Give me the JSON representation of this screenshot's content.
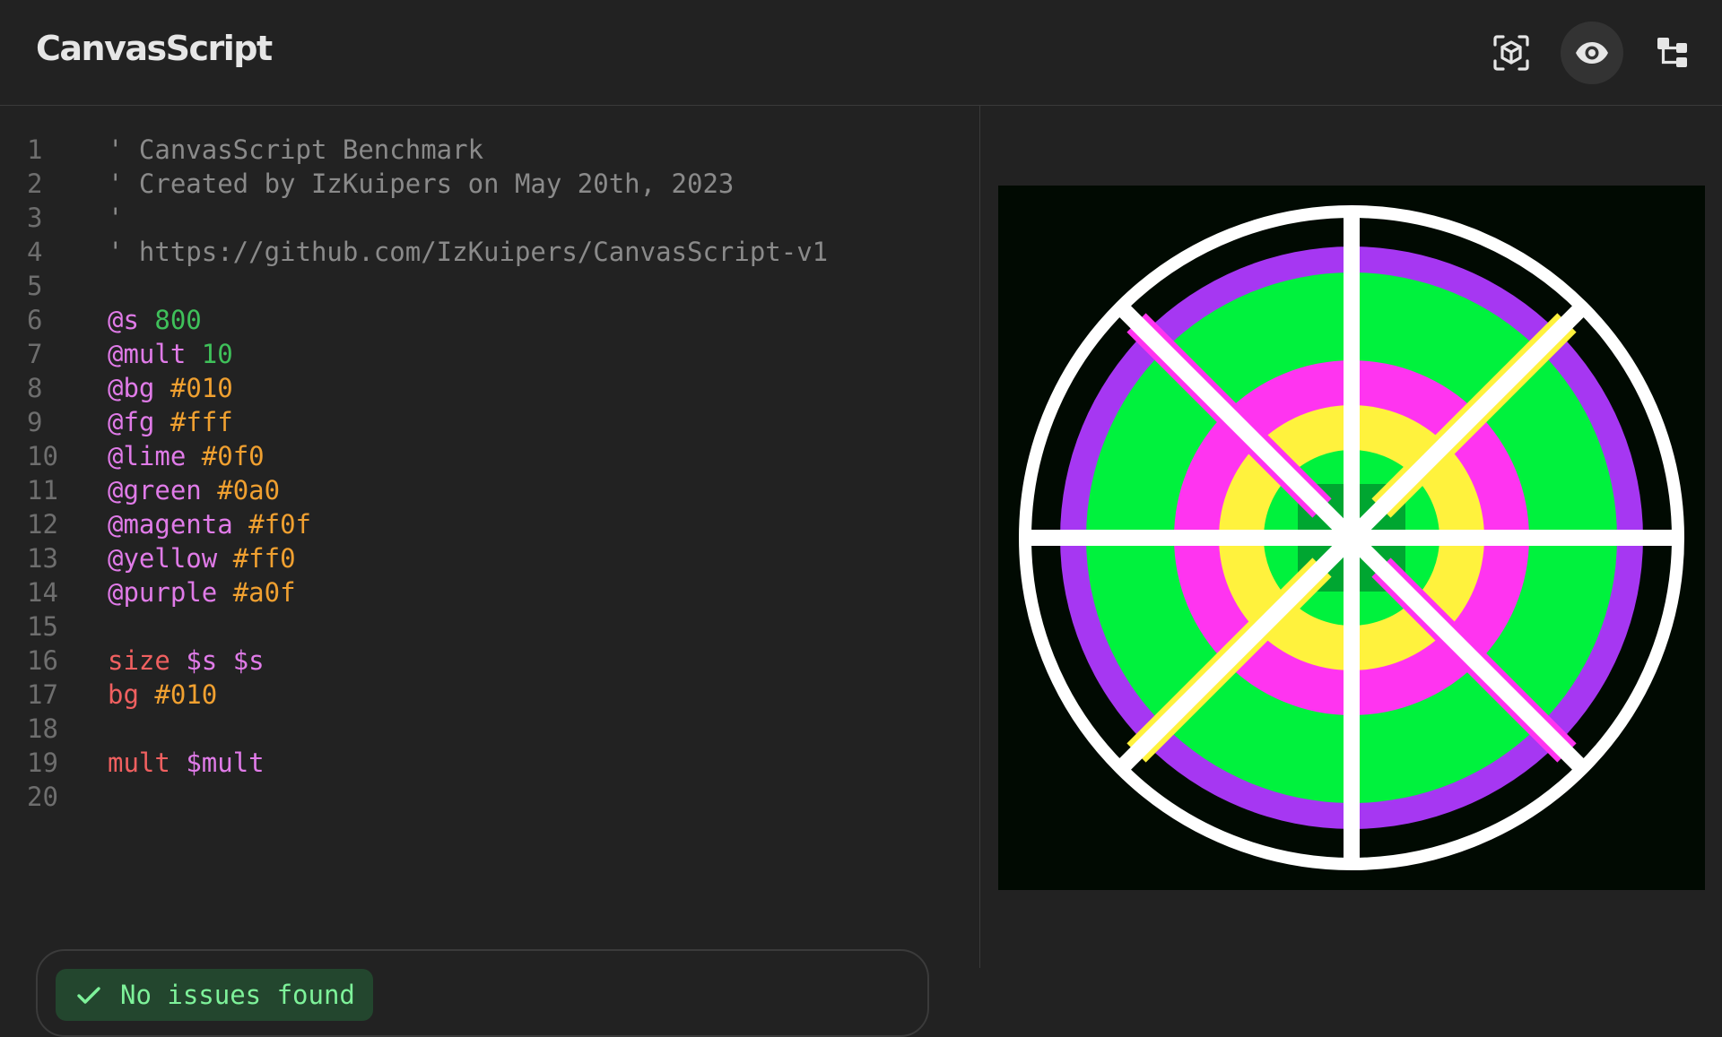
{
  "header": {
    "title": "CanvasScript",
    "icons": [
      "cube-scan-icon",
      "eye-icon",
      "tree-icon"
    ]
  },
  "editor": {
    "lines": [
      {
        "n": "1",
        "tokens": [
          {
            "t": "' CanvasScript Benchmark",
            "k": "comment"
          }
        ]
      },
      {
        "n": "2",
        "tokens": [
          {
            "t": "' Created by IzKuipers on May 20th, 2023",
            "k": "comment"
          }
        ]
      },
      {
        "n": "3",
        "tokens": [
          {
            "t": "'",
            "k": "comment"
          }
        ]
      },
      {
        "n": "4",
        "tokens": [
          {
            "t": "' https://github.com/IzKuipers/CanvasScript-v1",
            "k": "comment"
          }
        ]
      },
      {
        "n": "5",
        "tokens": []
      },
      {
        "n": "6",
        "tokens": [
          {
            "t": "@s",
            "k": "var"
          },
          {
            "t": " "
          },
          {
            "t": "800",
            "k": "num"
          }
        ]
      },
      {
        "n": "7",
        "tokens": [
          {
            "t": "@mult",
            "k": "var"
          },
          {
            "t": " "
          },
          {
            "t": "10",
            "k": "num"
          }
        ]
      },
      {
        "n": "8",
        "tokens": [
          {
            "t": "@bg",
            "k": "var"
          },
          {
            "t": " "
          },
          {
            "t": "#010",
            "k": "hex"
          }
        ]
      },
      {
        "n": "9",
        "tokens": [
          {
            "t": "@fg",
            "k": "var"
          },
          {
            "t": " "
          },
          {
            "t": "#fff",
            "k": "hex"
          }
        ]
      },
      {
        "n": "10",
        "tokens": [
          {
            "t": "@lime",
            "k": "var"
          },
          {
            "t": " "
          },
          {
            "t": "#0f0",
            "k": "hex"
          }
        ]
      },
      {
        "n": "11",
        "tokens": [
          {
            "t": "@green",
            "k": "var"
          },
          {
            "t": " "
          },
          {
            "t": "#0a0",
            "k": "hex"
          }
        ]
      },
      {
        "n": "12",
        "tokens": [
          {
            "t": "@magenta",
            "k": "var"
          },
          {
            "t": " "
          },
          {
            "t": "#f0f",
            "k": "hex"
          }
        ]
      },
      {
        "n": "13",
        "tokens": [
          {
            "t": "@yellow",
            "k": "var"
          },
          {
            "t": " "
          },
          {
            "t": "#ff0",
            "k": "hex"
          }
        ]
      },
      {
        "n": "14",
        "tokens": [
          {
            "t": "@purple",
            "k": "var"
          },
          {
            "t": " "
          },
          {
            "t": "#a0f",
            "k": "hex"
          }
        ]
      },
      {
        "n": "15",
        "tokens": []
      },
      {
        "n": "16",
        "tokens": [
          {
            "t": "size",
            "k": "cmd"
          },
          {
            "t": " "
          },
          {
            "t": "$s",
            "k": "var"
          },
          {
            "t": " "
          },
          {
            "t": "$s",
            "k": "var"
          }
        ]
      },
      {
        "n": "17",
        "tokens": [
          {
            "t": "bg",
            "k": "cmd"
          },
          {
            "t": " "
          },
          {
            "t": "#010",
            "k": "hex"
          }
        ]
      },
      {
        "n": "18",
        "tokens": []
      },
      {
        "n": "19",
        "tokens": [
          {
            "t": "mult",
            "k": "cmd"
          },
          {
            "t": " "
          },
          {
            "t": "$mult",
            "k": "var"
          }
        ]
      },
      {
        "n": "20",
        "tokens": []
      }
    ]
  },
  "status": {
    "text": "No issues found",
    "color": "#7ef29a"
  },
  "preview": {
    "background": "#010a02",
    "colors": {
      "white": "#ffffff",
      "purple": "#a637f2",
      "lime": "#00f23d",
      "magenta": "#ff34f0",
      "yellow": "#fff23d",
      "green": "#00a631"
    }
  }
}
